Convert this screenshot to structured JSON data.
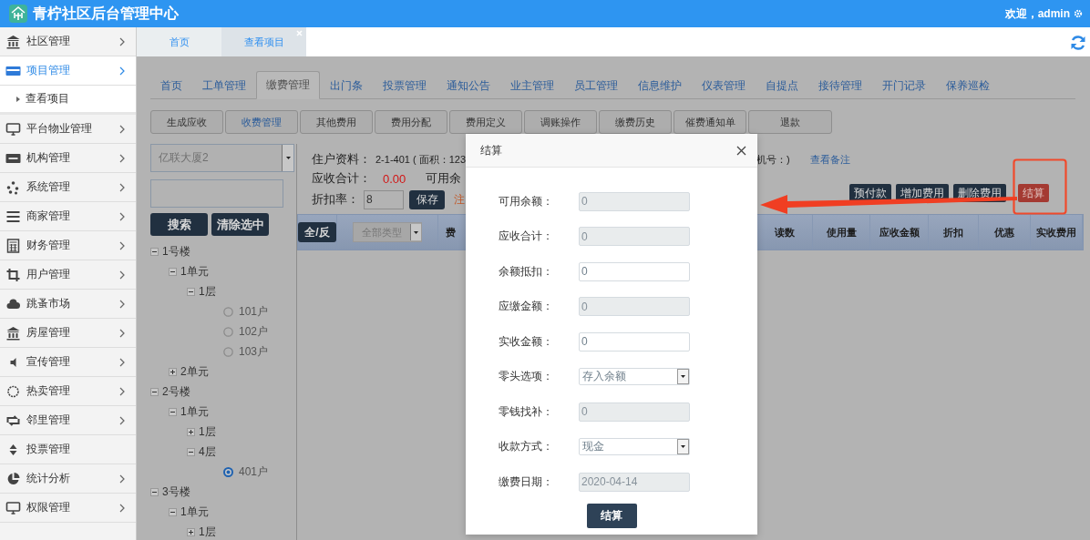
{
  "header": {
    "title": "青柠社区后台管理中心",
    "welcome": "欢迎，admin"
  },
  "sidebar": {
    "items": [
      {
        "label": "社区管理",
        "kind": "menu",
        "selected": false
      },
      {
        "label": "项目管理",
        "kind": "menu",
        "selected": true,
        "children": [
          {
            "label": "查看项目"
          }
        ]
      },
      {
        "label": "平台物业管理",
        "kind": "menu",
        "selected": false
      },
      {
        "label": "机构管理",
        "kind": "menu",
        "selected": false
      },
      {
        "label": "系统管理",
        "kind": "menu",
        "selected": false
      },
      {
        "label": "商家管理",
        "kind": "menu",
        "selected": false
      },
      {
        "label": "财务管理",
        "kind": "menu",
        "selected": false
      },
      {
        "label": "用户管理",
        "kind": "menu",
        "selected": false
      },
      {
        "label": "跳蚤市场",
        "kind": "menu",
        "selected": false
      },
      {
        "label": "房屋管理",
        "kind": "menu",
        "selected": false
      },
      {
        "label": "宣传管理",
        "kind": "menu",
        "selected": false
      },
      {
        "label": "热卖管理",
        "kind": "menu",
        "selected": false
      },
      {
        "label": "邻里管理",
        "kind": "menu",
        "selected": false
      },
      {
        "label": "投票管理",
        "kind": "link",
        "selected": false
      },
      {
        "label": "统计分析",
        "kind": "menu",
        "selected": false
      },
      {
        "label": "权限管理",
        "kind": "menu",
        "selected": false
      }
    ]
  },
  "page_tabs": [
    {
      "label": "首页",
      "selected": false,
      "closable": false
    },
    {
      "label": "查看项目",
      "selected": true,
      "closable": true
    }
  ],
  "module_tabs": [
    {
      "label": "首页",
      "selected": false
    },
    {
      "label": "工单管理",
      "selected": false
    },
    {
      "label": "缴费管理",
      "selected": true
    },
    {
      "label": "出门条",
      "selected": false
    },
    {
      "label": "投票管理",
      "selected": false
    },
    {
      "label": "通知公告",
      "selected": false
    },
    {
      "label": "业主管理",
      "selected": false
    },
    {
      "label": "员工管理",
      "selected": false
    },
    {
      "label": "信息维护",
      "selected": false
    },
    {
      "label": "仪表管理",
      "selected": false
    },
    {
      "label": "自提点",
      "selected": false
    },
    {
      "label": "接待管理",
      "selected": false
    },
    {
      "label": "开门记录",
      "selected": false
    },
    {
      "label": "保养巡检",
      "selected": false
    }
  ],
  "sub_tabs": [
    {
      "label": "生成应收",
      "selected": false
    },
    {
      "label": "收费管理",
      "selected": true
    },
    {
      "label": "其他费用",
      "selected": false
    },
    {
      "label": "费用分配",
      "selected": false
    },
    {
      "label": "费用定义",
      "selected": false
    },
    {
      "label": "调账操作",
      "selected": false
    },
    {
      "label": "缴费历史",
      "selected": false
    },
    {
      "label": "催费通知单",
      "selected": false
    },
    {
      "label": "退款",
      "selected": false
    }
  ],
  "filter": {
    "building": "亿联大厦2",
    "search_button": "搜索",
    "clear_button": "清除选中"
  },
  "tree": [
    {
      "label": "1号楼",
      "kind": "node",
      "expanded": true,
      "children": [
        {
          "label": "1单元",
          "kind": "node",
          "expanded": true,
          "children": [
            {
              "label": "1层",
              "kind": "node",
              "expanded": true,
              "children": [
                {
                  "label": "101户",
                  "kind": "house",
                  "selected": false
                },
                {
                  "label": "102户",
                  "kind": "house",
                  "selected": false
                },
                {
                  "label": "103户",
                  "kind": "house",
                  "selected": false
                }
              ]
            }
          ]
        },
        {
          "label": "2单元",
          "kind": "node",
          "expanded": false
        }
      ]
    },
    {
      "label": "2号楼",
      "kind": "node",
      "expanded": true,
      "children": [
        {
          "label": "1单元",
          "kind": "node",
          "expanded": true,
          "children": [
            {
              "label": "1层",
              "kind": "node",
              "expanded": false
            },
            {
              "label": "4层",
              "kind": "node",
              "expanded": true,
              "children": [
                {
                  "label": "401户",
                  "kind": "house",
                  "selected": true
                }
              ]
            }
          ]
        }
      ]
    },
    {
      "label": "3号楼",
      "kind": "node",
      "expanded": true,
      "children": [
        {
          "label": "1单元",
          "kind": "node",
          "expanded": true,
          "children": [
            {
              "label": "1层",
              "kind": "node",
              "expanded": false
            }
          ]
        }
      ]
    }
  ],
  "resident": {
    "label": "住户资料：",
    "value": "2-1-401 ( 面积：123",
    "value_tail": "机号：)",
    "link": "查看备注"
  },
  "receivable": {
    "label": "应收合计：",
    "value": "0.00",
    "balance_label": "可用余"
  },
  "discount": {
    "label": "折扣率：",
    "value": "8",
    "save": "保存",
    "note": "注"
  },
  "actions": [
    {
      "label": "预付款",
      "kind": "normal"
    },
    {
      "label": "增加费用",
      "kind": "normal"
    },
    {
      "label": "删除费用",
      "kind": "normal"
    },
    {
      "label": "结算",
      "kind": "danger"
    }
  ],
  "table": {
    "toggle": "全/反",
    "type_filter": "全部类型",
    "columns": [
      "费",
      "读数",
      "使用量",
      "应收金额",
      "折扣",
      "优惠",
      "实收费用"
    ]
  },
  "dialog": {
    "title": "结算",
    "fields": [
      {
        "label": "可用余额：",
        "kind": "readonly",
        "value": "0"
      },
      {
        "label": "应收合计：",
        "kind": "readonly",
        "value": "0"
      },
      {
        "label": "余额抵扣：",
        "kind": "input",
        "value": "0"
      },
      {
        "label": "应缴金额：",
        "kind": "readonly",
        "value": "0"
      },
      {
        "label": "实收金额：",
        "kind": "input",
        "value": "0"
      },
      {
        "label": "零头选项：",
        "kind": "select",
        "value": "存入余额"
      },
      {
        "label": "零钱找补：",
        "kind": "readonly",
        "value": "0"
      },
      {
        "label": "收款方式：",
        "kind": "select",
        "value": "现金"
      },
      {
        "label": "缴费日期：",
        "kind": "readonly",
        "value": "2020-04-14"
      }
    ],
    "submit": "结算"
  }
}
